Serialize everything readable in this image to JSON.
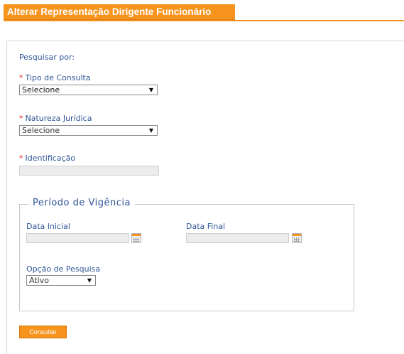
{
  "header": {
    "title": "Alterar Representação Dirigente Funcionário"
  },
  "form": {
    "search_by": "Pesquisar por:",
    "required_mark": "*",
    "tipo_consulta": {
      "label": "Tipo de Consulta",
      "value": "Selecione"
    },
    "natureza_juridica": {
      "label": "Natureza Jurídica",
      "value": "Selecione"
    },
    "identificacao": {
      "label": "Identificação",
      "value": ""
    },
    "periodo": {
      "legend": "Período de Vigência",
      "data_inicial": {
        "label": "Data Inicial",
        "value": ""
      },
      "data_final": {
        "label": "Data Final",
        "value": ""
      },
      "opcao_pesquisa": {
        "label": "Opção de Pesquisa",
        "value": "Ativo"
      }
    },
    "submit_label": "Consultar"
  },
  "colors": {
    "accent": "#f7941d",
    "label": "#2f5597",
    "required": "#dd2222"
  }
}
